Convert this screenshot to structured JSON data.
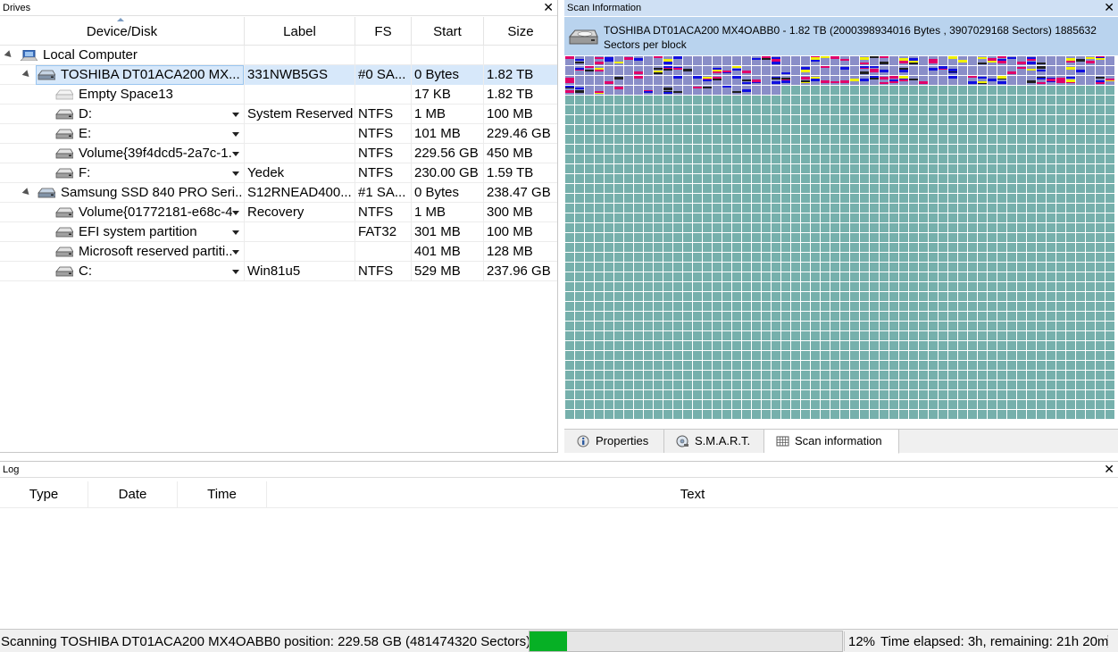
{
  "drives": {
    "title": "Drives",
    "columns": [
      "Device/Disk",
      "Label",
      "FS",
      "Start",
      "Size"
    ],
    "rows": [
      {
        "device": "Local Computer",
        "label": "",
        "fs": "",
        "start": "",
        "size": "",
        "indent": 0,
        "icon": "computer-icon",
        "expanded": true
      },
      {
        "device": "TOSHIBA DT01ACA200 MX...",
        "label": "331NWB5GS",
        "fs": "#0 SA...",
        "start": "0 Bytes",
        "size": "1.82 TB",
        "indent": 1,
        "icon": "hard-disk-icon",
        "expanded": true,
        "selected": true
      },
      {
        "device": "Empty Space13",
        "label": "",
        "fs": "",
        "start": "17 KB",
        "size": "1.82 TB",
        "indent": 2,
        "icon": "empty-space-icon"
      },
      {
        "device": "D:",
        "label": "System Reserved",
        "fs": "NTFS",
        "start": "1 MB",
        "size": "100 MB",
        "indent": 2,
        "icon": "partition-icon",
        "dropdown": true
      },
      {
        "device": "E:",
        "label": "",
        "fs": "NTFS",
        "start": "101 MB",
        "size": "229.46 GB",
        "indent": 2,
        "icon": "partition-icon",
        "dropdown": true
      },
      {
        "device": "Volume{39f4dcd5-2a7c-1...",
        "label": "",
        "fs": "NTFS",
        "start": "229.56 GB",
        "size": "450 MB",
        "indent": 2,
        "icon": "partition-icon",
        "dropdown": true
      },
      {
        "device": "F:",
        "label": "Yedek",
        "fs": "NTFS",
        "start": "230.00 GB",
        "size": "1.59 TB",
        "indent": 2,
        "icon": "partition-icon",
        "dropdown": true
      },
      {
        "device": "Samsung SSD 840 PRO Seri...",
        "label": "S12RNEAD400...",
        "fs": "#1 SA...",
        "start": "0 Bytes",
        "size": "238.47 GB",
        "indent": 1,
        "icon": "hard-disk-icon",
        "expanded": true
      },
      {
        "device": "Volume{01772181-e68c-4...",
        "label": "Recovery",
        "fs": "NTFS",
        "start": "1 MB",
        "size": "300 MB",
        "indent": 2,
        "icon": "partition-icon",
        "dropdown": true
      },
      {
        "device": "EFI system partition",
        "label": "",
        "fs": "FAT32",
        "start": "301 MB",
        "size": "100 MB",
        "indent": 2,
        "icon": "partition-icon",
        "dropdown": true
      },
      {
        "device": "Microsoft reserved partiti...",
        "label": "",
        "fs": "",
        "start": "401 MB",
        "size": "128 MB",
        "indent": 2,
        "icon": "partition-icon",
        "dropdown": true
      },
      {
        "device": "C:",
        "label": "Win81u5",
        "fs": "NTFS",
        "start": "529 MB",
        "size": "237.96 GB",
        "indent": 2,
        "icon": "partition-icon",
        "dropdown": true
      }
    ]
  },
  "scan": {
    "title": "Scan Information",
    "header_line1": "TOSHIBA DT01ACA200 MX4OABB0 - 1.82 TB (2000398934016 Bytes , 3907029168 Sectors) 1885632",
    "header_line2": "Sectors per block",
    "colors": {
      "empty": "#76b0ac",
      "scanned": "#8a8ec8",
      "red": "#e0006a",
      "blue": "#1010e0",
      "yellow": "#f0f000",
      "dark": "#202020",
      "white": "#ffffff"
    },
    "scanned_rows": 4,
    "scanned_last_row_cells": 22,
    "tabs": [
      {
        "label": "Properties",
        "icon": "properties-icon"
      },
      {
        "label": "S.M.A.R.T.",
        "icon": "smart-disk-icon"
      },
      {
        "label": "Scan information",
        "icon": "scan-grid-icon",
        "active": true
      }
    ]
  },
  "log": {
    "title": "Log",
    "columns": [
      "Type",
      "Date",
      "Time",
      "Text"
    ]
  },
  "status": {
    "message": "Scanning TOSHIBA DT01ACA200 MX4OABB0 position: 229.58 GB (481474320 Sectors)",
    "progress_percent": 12,
    "percent_label": "12%",
    "time_text": "Time elapsed: 3h, remaining: 21h 20m",
    "progress_color": "#06b025"
  }
}
